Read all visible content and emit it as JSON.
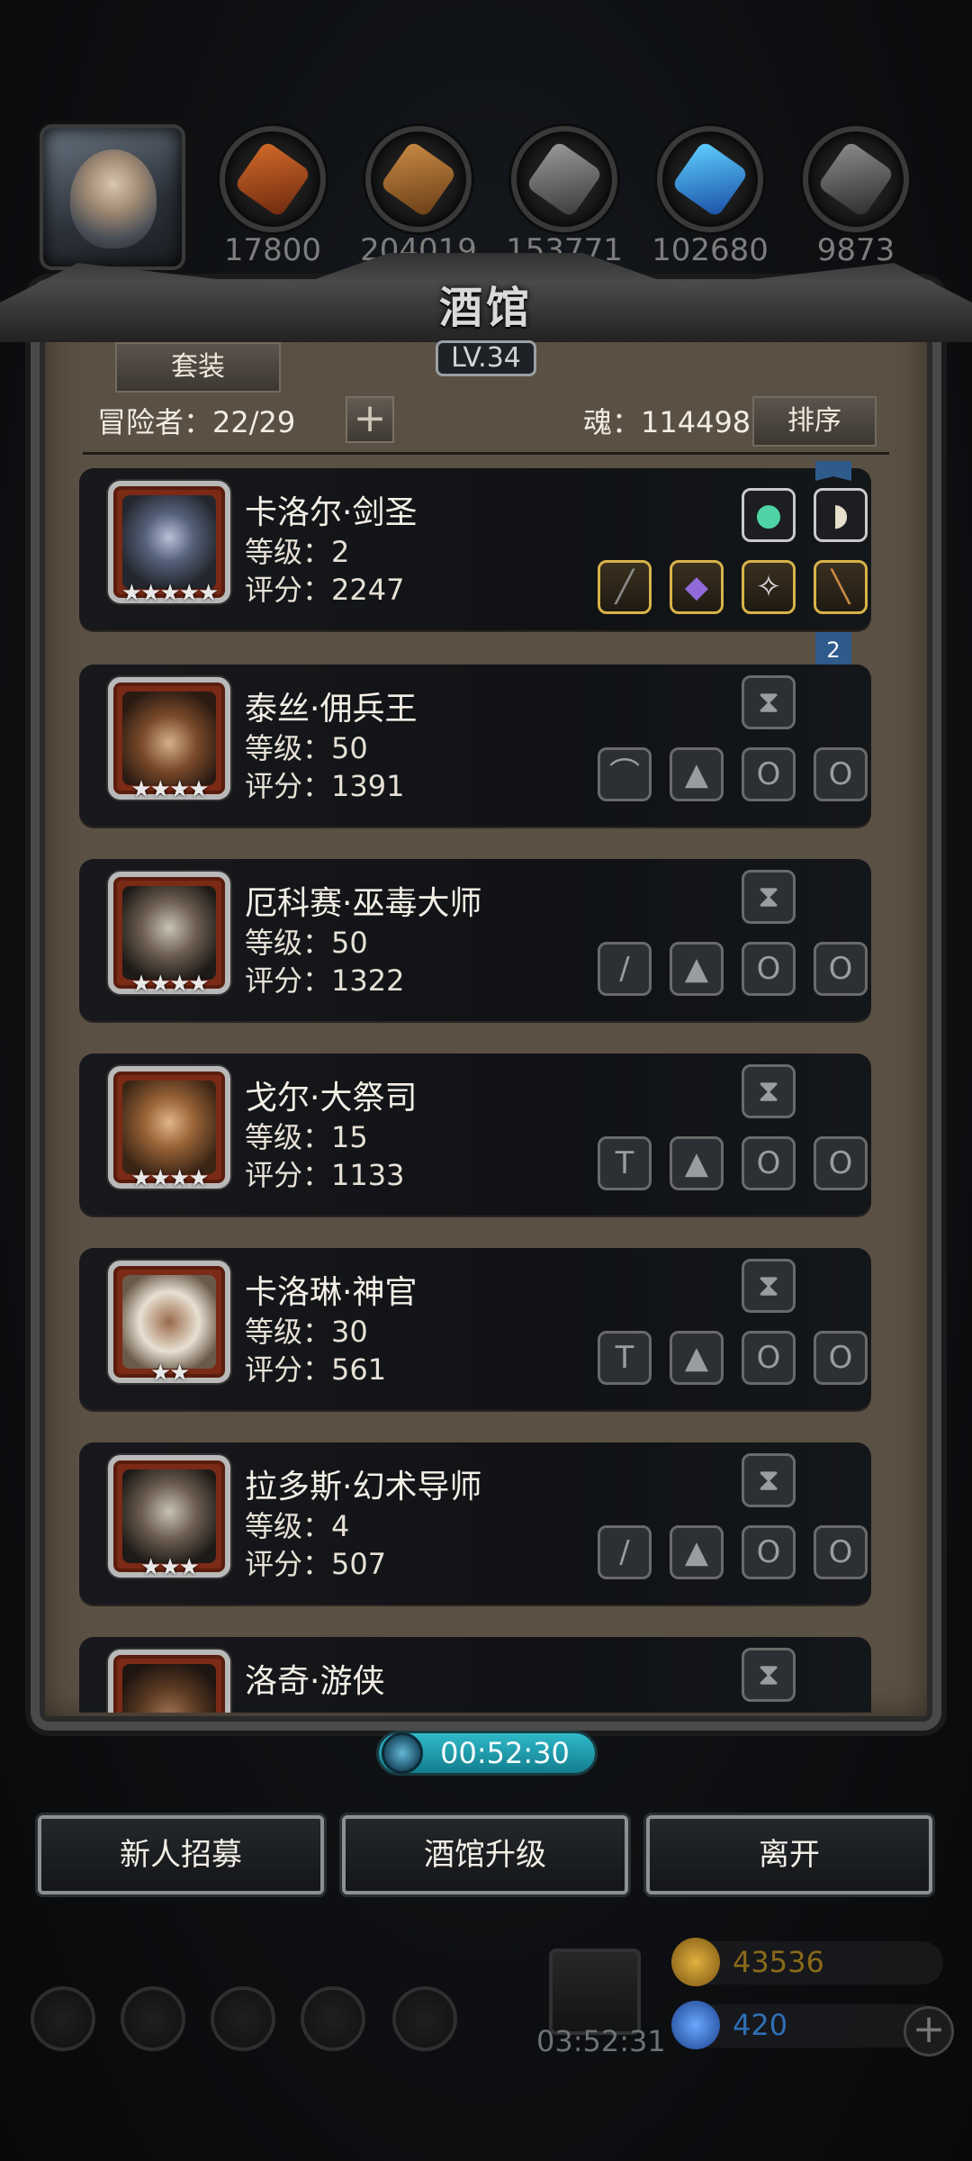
{
  "resources": [
    {
      "icon": "meat-icon",
      "value": "17800"
    },
    {
      "icon": "wood-icon",
      "value": "204019"
    },
    {
      "icon": "iron-icon",
      "value": "153771"
    },
    {
      "icon": "crystal-icon",
      "value": "102680"
    },
    {
      "icon": "stone-icon",
      "value": "9873"
    }
  ],
  "panel": {
    "title": "酒馆",
    "level": "LV.34",
    "set_button": "套装",
    "adventurer_label": "冒险者：22/29",
    "add_button": "+",
    "soul_label": "魂：114498",
    "sort_button": "排序"
  },
  "heroes": [
    {
      "name": "卡洛尔·剑圣",
      "level": "等级：2",
      "score": "评分：2247",
      "stars": "★★★★★"
    },
    {
      "name": "泰丝·佣兵王",
      "level": "等级：50",
      "score": "评分：1391",
      "stars": "★★★★"
    },
    {
      "name": "厄科赛·巫毒大师",
      "level": "等级：50",
      "score": "评分：1322",
      "stars": "★★★★"
    },
    {
      "name": "戈尔·大祭司",
      "level": "等级：15",
      "score": "评分：1133",
      "stars": "★★★★"
    },
    {
      "name": "卡洛琳·神官",
      "level": "等级：30",
      "score": "评分：561",
      "stars": "★★"
    },
    {
      "name": "拉多斯·幻术导师",
      "level": "等级：4",
      "score": "评分：507",
      "stars": "★★★"
    },
    {
      "name": "洛奇·游侠",
      "level": "",
      "score": "",
      "stars": ""
    }
  ],
  "ribbon_badge": "2",
  "timer": "00:52:30",
  "buttons": {
    "recruit": "新人招募",
    "upgrade": "酒馆升级",
    "leave": "离开"
  },
  "hud": {
    "gift_timer": "03:52:31",
    "gold": "43536",
    "gems": "420",
    "add": "+"
  },
  "colors": {
    "accent_timer": "#2fb9c9",
    "gold_text": "#8a6a1a",
    "gem_text": "#2f6fb5",
    "frame": "#5b5044"
  }
}
